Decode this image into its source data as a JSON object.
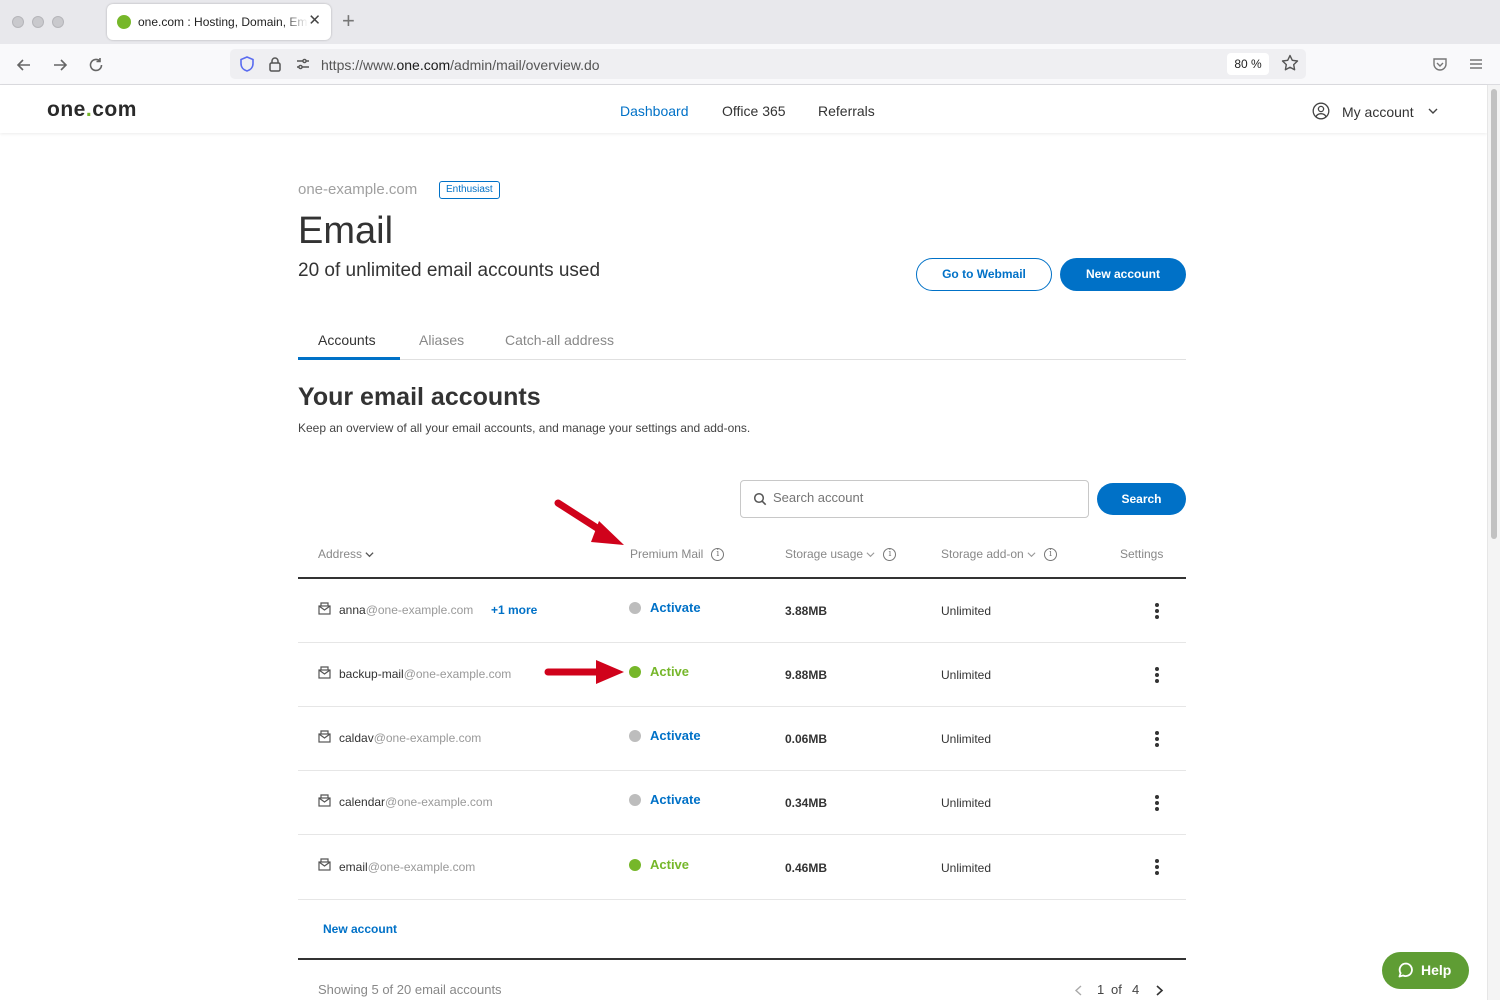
{
  "browser": {
    "tab_title": "one.com : Hosting, Domain, Email",
    "url_prefix": "https://www.",
    "url_host": "one.com",
    "url_path": "/admin/mail/overview.do",
    "zoom": "80 %"
  },
  "header": {
    "logo_pre": "one",
    "logo_dot": ".",
    "logo_post": "com",
    "nav": [
      "Dashboard",
      "Office 365",
      "Referrals"
    ],
    "account_label": "My account"
  },
  "page": {
    "domain": "one-example.com",
    "plan_badge": "Enthusiast",
    "title": "Email",
    "usage": "20 of unlimited email accounts used",
    "webmail_button": "Go to Webmail",
    "new_account_button": "New account",
    "tabs": [
      "Accounts",
      "Aliases",
      "Catch-all address"
    ],
    "section_title": "Your email accounts",
    "section_desc": "Keep an overview of all your email accounts, and manage your settings and add-ons.",
    "search_placeholder": "Search account",
    "search_button": "Search"
  },
  "table": {
    "columns": {
      "address": "Address",
      "premium": "Premium Mail",
      "storage": "Storage usage",
      "addon": "Storage add-on",
      "settings": "Settings"
    },
    "rows": [
      {
        "user": "anna",
        "domain": "@one-example.com",
        "more": "+1 more",
        "status": "Activate",
        "status_state": "inactive",
        "storage": "3.88MB",
        "addon": "Unlimited"
      },
      {
        "user": "backup-mail",
        "domain": "@one-example.com",
        "more": "",
        "status": "Active",
        "status_state": "active",
        "storage": "9.88MB",
        "addon": "Unlimited"
      },
      {
        "user": "caldav",
        "domain": "@one-example.com",
        "more": "",
        "status": "Activate",
        "status_state": "inactive",
        "storage": "0.06MB",
        "addon": "Unlimited"
      },
      {
        "user": "calendar",
        "domain": "@one-example.com",
        "more": "",
        "status": "Activate",
        "status_state": "inactive",
        "storage": "0.34MB",
        "addon": "Unlimited"
      },
      {
        "user": "email",
        "domain": "@one-example.com",
        "more": "",
        "status": "Active",
        "status_state": "active",
        "storage": "0.46MB",
        "addon": "Unlimited"
      }
    ],
    "new_account_link": "New account",
    "showing": "Showing 5 of 20 email accounts",
    "pager": {
      "current": "1",
      "of": "of",
      "total": "4"
    }
  },
  "help_button": "Help",
  "colors": {
    "brand_blue": "#0071c7",
    "brand_green": "#76b72a",
    "help_green": "#5f9d34",
    "annotation_red": "#d0021b"
  }
}
